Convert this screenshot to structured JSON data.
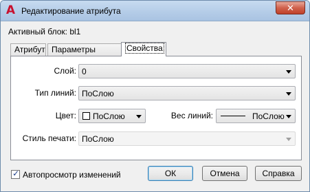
{
  "window": {
    "title": "Редактирование атрибута",
    "app_icon": "autocad-icon",
    "close_glyph": "✕"
  },
  "active_block": "Активный блок: bl1",
  "tabs": [
    {
      "label": "Атрибут",
      "active": false
    },
    {
      "label": "Параметры текста",
      "active": false
    },
    {
      "label": "Свойства",
      "active": true
    }
  ],
  "properties": {
    "layer": {
      "label": "Слой:",
      "value": "0"
    },
    "linetype": {
      "label": "Тип линий:",
      "value": "ПоСлою"
    },
    "color": {
      "label": "Цвет:",
      "value": "ПоСлою"
    },
    "lineweight": {
      "label": "Вес линий:",
      "value": "ПоСлою"
    },
    "plot_style": {
      "label": "Стиль печати:",
      "value": "ПоСлою",
      "disabled": true
    }
  },
  "autopreview": {
    "label": "Автопросмотр изменений",
    "checked": true
  },
  "buttons": {
    "ok": "ОК",
    "cancel": "Отмена",
    "help": "Справка"
  }
}
